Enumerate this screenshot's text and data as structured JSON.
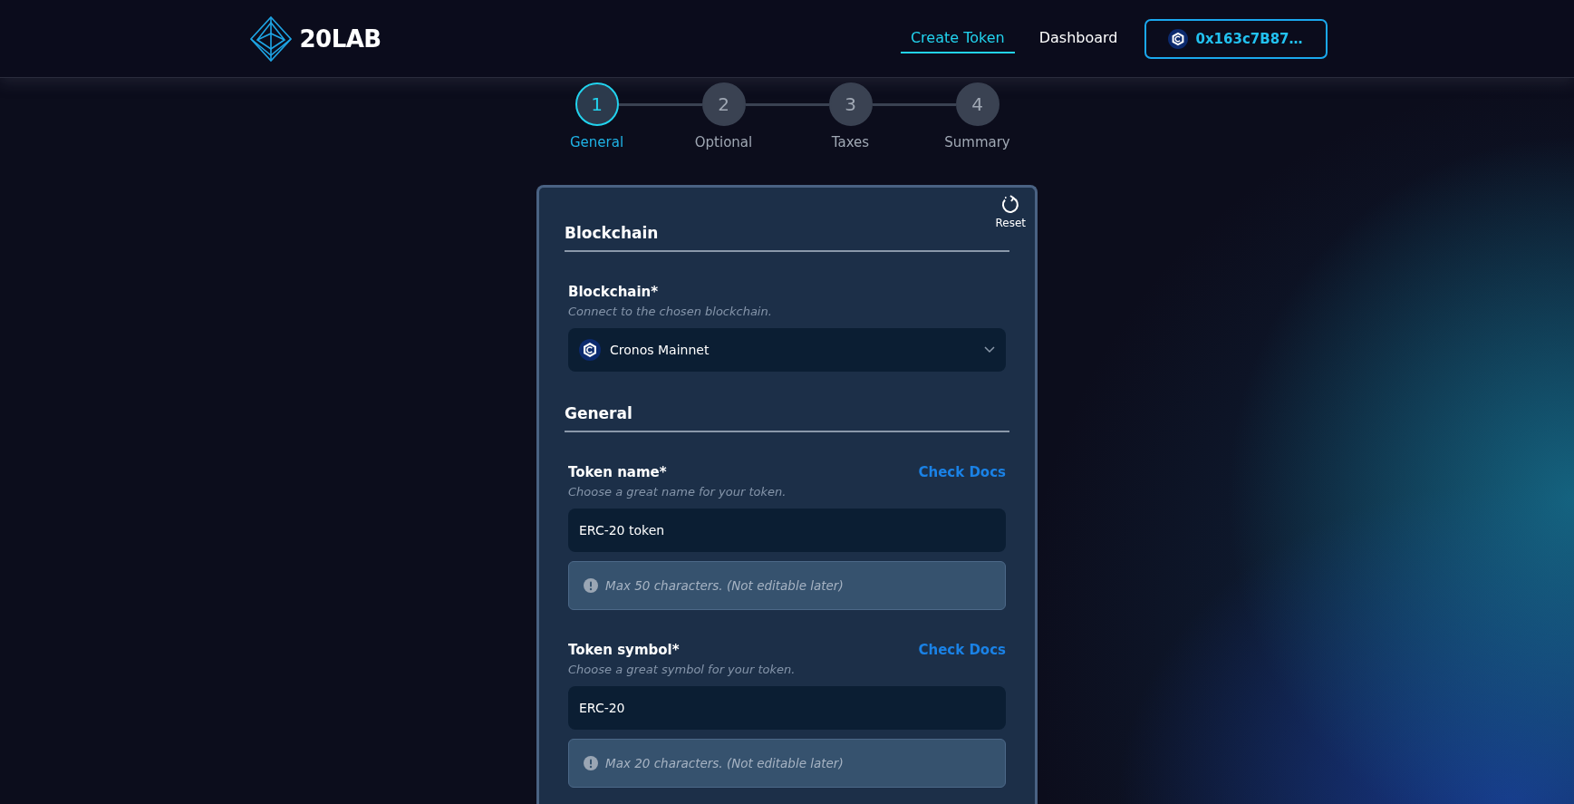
{
  "header": {
    "logo": "20LAB",
    "nav": [
      {
        "label": "Create Token",
        "selected": true
      },
      {
        "label": "Dashboard",
        "selected": false
      }
    ],
    "wallet": {
      "address": "0x163c7B87…"
    }
  },
  "stepper": [
    {
      "number": "1",
      "label": "General",
      "selected": true
    },
    {
      "number": "2",
      "label": "Optional",
      "selected": false
    },
    {
      "number": "3",
      "label": "Taxes",
      "selected": false
    },
    {
      "number": "4",
      "label": "Summary",
      "selected": false
    }
  ],
  "form": {
    "reset": "Reset",
    "sections": [
      {
        "title": "Blockchain",
        "fields": [
          {
            "kind": "select",
            "label": "Blockchain*",
            "description": "Connect to the chosen blockchain.",
            "value": "Cronos Mainnet"
          }
        ]
      },
      {
        "title": "General",
        "fields": [
          {
            "kind": "text",
            "label": "Token name*",
            "link": "Check Docs",
            "description": "Choose a great name for your token.",
            "value": "ERC-20 token",
            "note": "Max 50 characters. (Not editable later)"
          },
          {
            "kind": "text",
            "label": "Token symbol*",
            "link": "Check Docs",
            "description": "Choose a great symbol for your token.",
            "value": "ERC-20",
            "note": "Max 20 characters. (Not editable later)"
          }
        ]
      }
    ]
  }
}
